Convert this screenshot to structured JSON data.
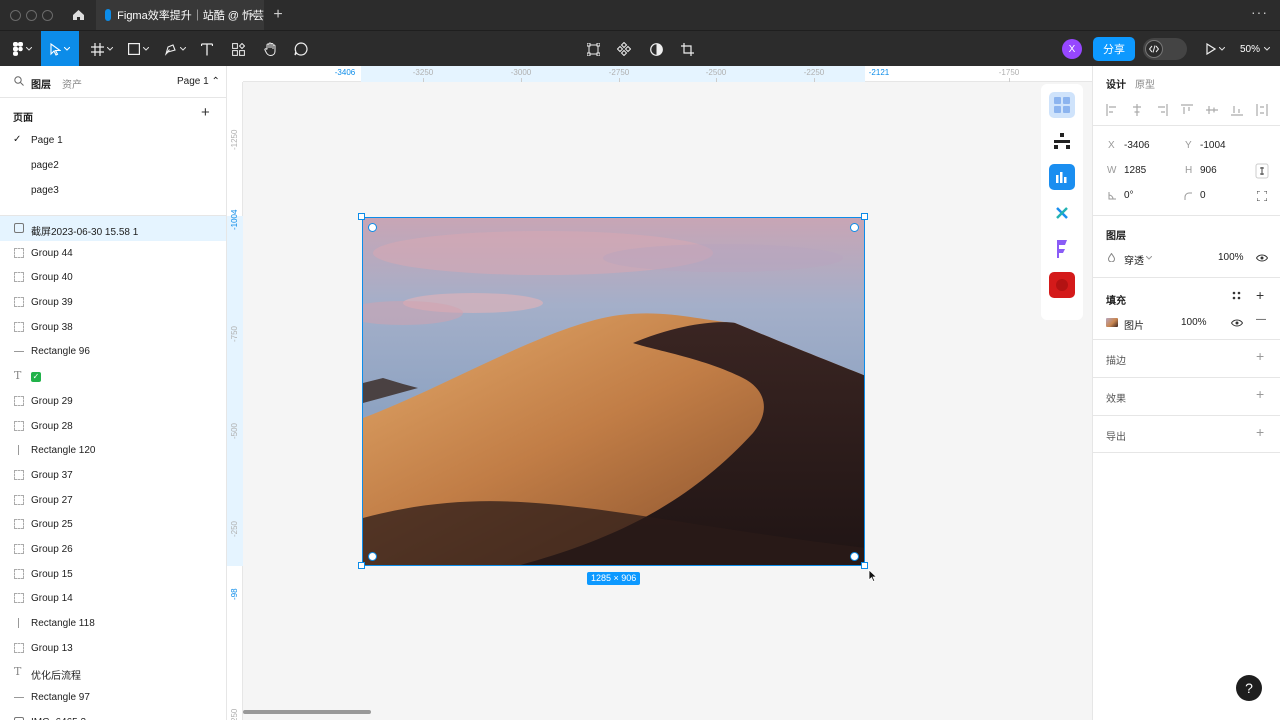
{
  "tabbar": {
    "tab_title": "Figma效率提升｜站酷 @ 忻芸",
    "close_glyph": "×",
    "new_tab_glyph": "+",
    "more_glyph": "···"
  },
  "toolbar": {
    "share_label": "分享",
    "avatar_initial": "X",
    "zoom_label": "50%"
  },
  "left_panel": {
    "tabs": [
      "图层",
      "资产"
    ],
    "page_selector": "Page 1 ⌃",
    "pages_title": "页面",
    "add_glyph": "+",
    "pages": [
      {
        "name": "Page 1",
        "current": true,
        "check": "✓"
      },
      {
        "name": "page2",
        "current": false,
        "check": ""
      },
      {
        "name": "page3",
        "current": false,
        "check": ""
      }
    ],
    "layers": [
      {
        "name": "截屏2023-06-30 15.58 1",
        "type": "image",
        "selected": true
      },
      {
        "name": "Group 44",
        "type": "group"
      },
      {
        "name": "Group 40",
        "type": "group"
      },
      {
        "name": "Group 39",
        "type": "group"
      },
      {
        "name": "Group 38",
        "type": "group"
      },
      {
        "name": "Rectangle 96",
        "type": "line"
      },
      {
        "name": "✅",
        "type": "text-emoji"
      },
      {
        "name": "Group 29",
        "type": "group"
      },
      {
        "name": "Group 28",
        "type": "group"
      },
      {
        "name": "Rectangle 120",
        "type": "vline"
      },
      {
        "name": "Group 37",
        "type": "group"
      },
      {
        "name": "Group 27",
        "type": "group"
      },
      {
        "name": "Group 25",
        "type": "group"
      },
      {
        "name": "Group 26",
        "type": "group"
      },
      {
        "name": "Group 15",
        "type": "group"
      },
      {
        "name": "Group 14",
        "type": "group"
      },
      {
        "name": "Rectangle 118",
        "type": "vline"
      },
      {
        "name": "Group 13",
        "type": "group"
      },
      {
        "name": "优化后流程",
        "type": "text"
      },
      {
        "name": "Rectangle 97",
        "type": "line"
      },
      {
        "name": "IMG_6465 3",
        "type": "image"
      }
    ]
  },
  "canvas": {
    "ruler_top": [
      {
        "label": "-3406",
        "hi": true
      },
      {
        "label": "-3250",
        "hi": false
      },
      {
        "label": "-3000",
        "hi": false
      },
      {
        "label": "-2750",
        "hi": false
      },
      {
        "label": "-2500",
        "hi": false
      },
      {
        "label": "-2250",
        "hi": false
      },
      {
        "label": "-2121",
        "hi": true
      },
      {
        "label": "-1750",
        "hi": false
      }
    ],
    "ruler_left": [
      {
        "label": "-1250",
        "hi": false
      },
      {
        "label": "-1004",
        "hi": true
      },
      {
        "label": "-750",
        "hi": false
      },
      {
        "label": "-500",
        "hi": false
      },
      {
        "label": "-250",
        "hi": false
      },
      {
        "label": "-98",
        "hi": true
      },
      {
        "label": "250",
        "hi": false
      }
    ],
    "dimension_label": "1285 × 906"
  },
  "right_panel": {
    "tabs": [
      "设计",
      "原型"
    ],
    "x_label": "X",
    "x_value": "-3406",
    "y_label": "Y",
    "y_value": "-1004",
    "w_label": "W",
    "w_value": "1285",
    "h_label": "H",
    "h_value": "906",
    "rotation": "0°",
    "radius": "0",
    "layer_title": "图层",
    "blend_mode": "穿透",
    "layer_opacity": "100%",
    "fill_title": "填充",
    "fill_type": "图片",
    "fill_opacity": "100%",
    "stroke_title": "描边",
    "effects_title": "效果",
    "export_title": "导出",
    "plus": "+",
    "minus": "—"
  },
  "help_glyph": "?",
  "colors": {
    "accent": "#0c8ce9",
    "share_button": "#0d99ff",
    "avatar": "#9747ff",
    "toolbar_bg": "#2c2c2c"
  }
}
